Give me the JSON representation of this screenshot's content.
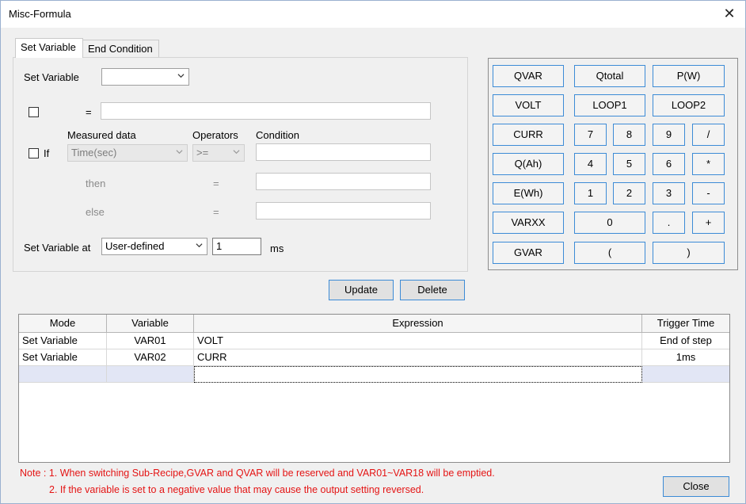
{
  "window": {
    "title": "Misc-Formula",
    "close_glyph": "✕"
  },
  "tabs": [
    {
      "label": "Set Variable",
      "active": true
    },
    {
      "label": "End Condition",
      "active": false
    }
  ],
  "set_variable": {
    "label": "Set Variable",
    "value": "",
    "equals": "=",
    "expression_value": ""
  },
  "if_section": {
    "if_label": "If",
    "measured_header": "Measured data",
    "operators_header": "Operators",
    "condition_header": "Condition",
    "measured_value": "Time(sec)",
    "operator_value": ">=",
    "condition_value": "",
    "then_label": "then",
    "then_equals": "=",
    "then_value": "",
    "else_label": "else",
    "else_equals": "=",
    "else_value": ""
  },
  "set_at": {
    "label": "Set Variable at",
    "mode_value": "User-defined",
    "time_value": "1",
    "unit": "ms"
  },
  "keypad": {
    "rows": [
      [
        "QVAR",
        "Qtotal",
        "P(W)"
      ],
      [
        "VOLT",
        "LOOP1",
        "LOOP2"
      ],
      [
        "CURR",
        "7",
        "8",
        "9",
        "/"
      ],
      [
        "Q(Ah)",
        "4",
        "5",
        "6",
        "*"
      ],
      [
        "E(Wh)",
        "1",
        "2",
        "3",
        "-"
      ],
      [
        "VARXX",
        "0",
        ".",
        "+"
      ],
      [
        "GVAR",
        "(",
        ")"
      ]
    ]
  },
  "actions": {
    "update": "Update",
    "delete": "Delete",
    "close": "Close"
  },
  "table": {
    "columns": [
      "Mode",
      "Variable",
      "Expression",
      "Trigger Time"
    ],
    "rows": [
      {
        "mode": "Set Variable",
        "variable": "VAR01",
        "expression": "VOLT",
        "trigger": "End of step"
      },
      {
        "mode": "Set Variable",
        "variable": "VAR02",
        "expression": "CURR",
        "trigger": "1ms"
      }
    ]
  },
  "notes": [
    "Note : 1. When switching Sub-Recipe,GVAR and QVAR will be reserved and VAR01~VAR18 will be emptied.",
    "2. If the variable is set to a negative value that may cause the output setting reversed."
  ],
  "colors": {
    "accent_border": "#3c8bd6",
    "note_red": "#e41414",
    "new_row": "#e2e6f5"
  }
}
